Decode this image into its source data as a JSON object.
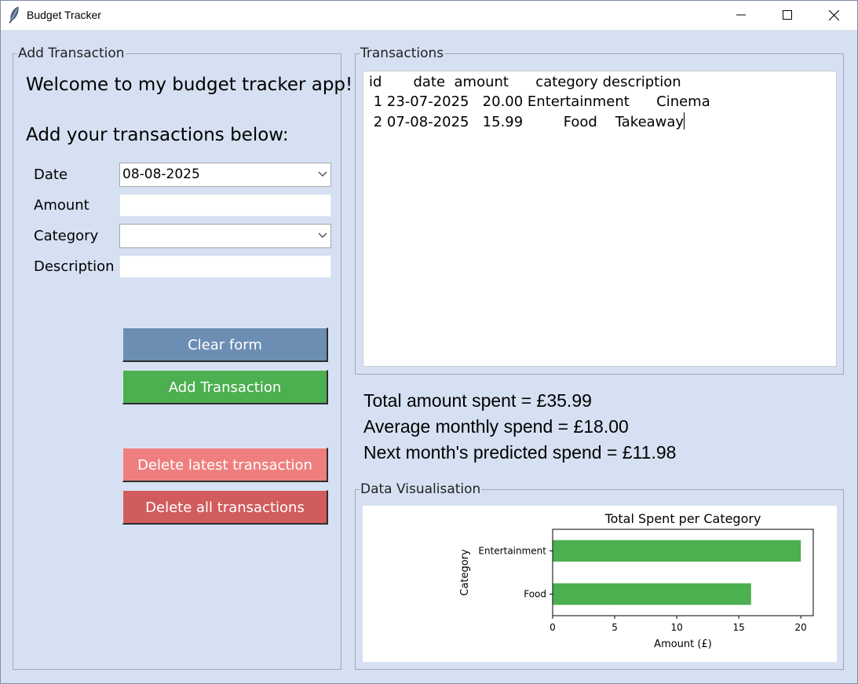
{
  "window": {
    "title": "Budget Tracker",
    "icon": "feather-icon"
  },
  "add_panel": {
    "legend": "Add Transaction",
    "welcome": "Welcome to my budget tracker app!",
    "instruction": "Add your transactions below:",
    "date_label": "Date",
    "date_value": "08-08-2025",
    "amount_label": "Amount",
    "amount_value": "",
    "category_label": "Category",
    "category_value": "",
    "description_label": "Description",
    "description_value": "",
    "clear_button": "Clear form",
    "add_button": "Add Transaction",
    "delete_latest_button": "Delete latest transaction",
    "delete_all_button": "Delete all transactions"
  },
  "transactions_panel": {
    "legend": "Transactions",
    "header": "id       date  amount      category description",
    "rows": [
      " 1 23-07-2025   20.00 Entertainment      Cinema",
      " 2 07-08-2025   15.99         Food    Takeaway"
    ]
  },
  "stats": {
    "total": "Total amount spent = £35.99",
    "average": "Average monthly spend = £18.00",
    "prediction": "Next month's predicted spend = £11.98"
  },
  "viz_panel": {
    "legend": "Data Visualisation"
  },
  "colors": {
    "background": "#d5e0f2",
    "clear_button": "#6b8eb2",
    "add_button": "#4caf50",
    "delete_latest_button": "#ef7f7f",
    "delete_all_button": "#d15c5e",
    "bar": "#4caf50"
  },
  "chart_data": {
    "type": "bar",
    "orientation": "horizontal",
    "title": "Total Spent per Category",
    "xlabel": "Amount (£)",
    "ylabel": "Category",
    "categories": [
      "Entertainment",
      "Food"
    ],
    "values": [
      20.0,
      15.99
    ],
    "xlim": [
      0,
      21
    ],
    "xticks": [
      0,
      5,
      10,
      15,
      20
    ],
    "grid": false
  }
}
